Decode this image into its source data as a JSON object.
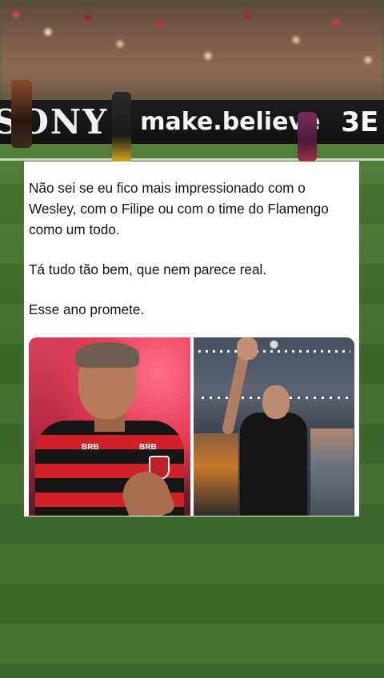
{
  "background": {
    "adboard": {
      "brand": "SONY",
      "tagline": "make.believe",
      "extra": "3E"
    }
  },
  "tweet": {
    "paragraphs": [
      "Não sei se eu fico mais impressionado com o Wesley, com o Filipe ou com o time do Flamengo como um todo.",
      "Tá tudo tão bem, que nem parece real.",
      "Esse ano promete."
    ],
    "media": {
      "left": {
        "sponsor_a": "BRB",
        "sponsor_b": "BRB"
      },
      "right": {}
    }
  },
  "colors": {
    "card_background": "#ffffff",
    "text": "#141414",
    "jersey_red": "#d0202a",
    "jersey_black": "#161616",
    "pitch_green": "#416d2d"
  }
}
